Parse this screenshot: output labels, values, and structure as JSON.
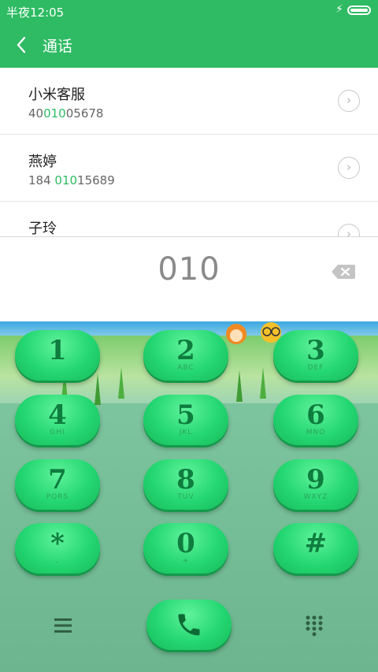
{
  "status_bar": {
    "time": "半夜12:05",
    "charging_icon": "bolt-icon"
  },
  "header": {
    "title": "通话",
    "back_icon": "chevron-left-icon"
  },
  "results": [
    {
      "name": "小米客服",
      "num_before": "40",
      "num_match": "010",
      "num_after": "05678"
    },
    {
      "name": "燕婷",
      "num_before": "184 ",
      "num_match": "010",
      "num_after": "15689"
    },
    {
      "name": "子玲",
      "num_before": "",
      "num_match": "",
      "num_after": ""
    }
  ],
  "input": {
    "digits": "010",
    "delete_icon": "backspace-icon"
  },
  "keypad": {
    "keys": [
      {
        "digit": "1",
        "letters": ""
      },
      {
        "digit": "2",
        "letters": "ABC"
      },
      {
        "digit": "3",
        "letters": "DEF"
      },
      {
        "digit": "4",
        "letters": "GHI"
      },
      {
        "digit": "5",
        "letters": "JKL"
      },
      {
        "digit": "6",
        "letters": "MNO"
      },
      {
        "digit": "7",
        "letters": "PQRS"
      },
      {
        "digit": "8",
        "letters": "TUV"
      },
      {
        "digit": "9",
        "letters": "WXYZ"
      },
      {
        "digit": "*",
        "letters": ","
      },
      {
        "digit": "0",
        "letters": "+"
      },
      {
        "digit": "#",
        "letters": ""
      }
    ]
  },
  "bottom_bar": {
    "menu_icon": "menu-icon",
    "call_icon": "phone-icon",
    "dialpad_icon": "dialpad-icon"
  },
  "colors": {
    "accent": "#2ebb63",
    "match_highlight": "#2ebb63",
    "key_green": "#24d772"
  }
}
